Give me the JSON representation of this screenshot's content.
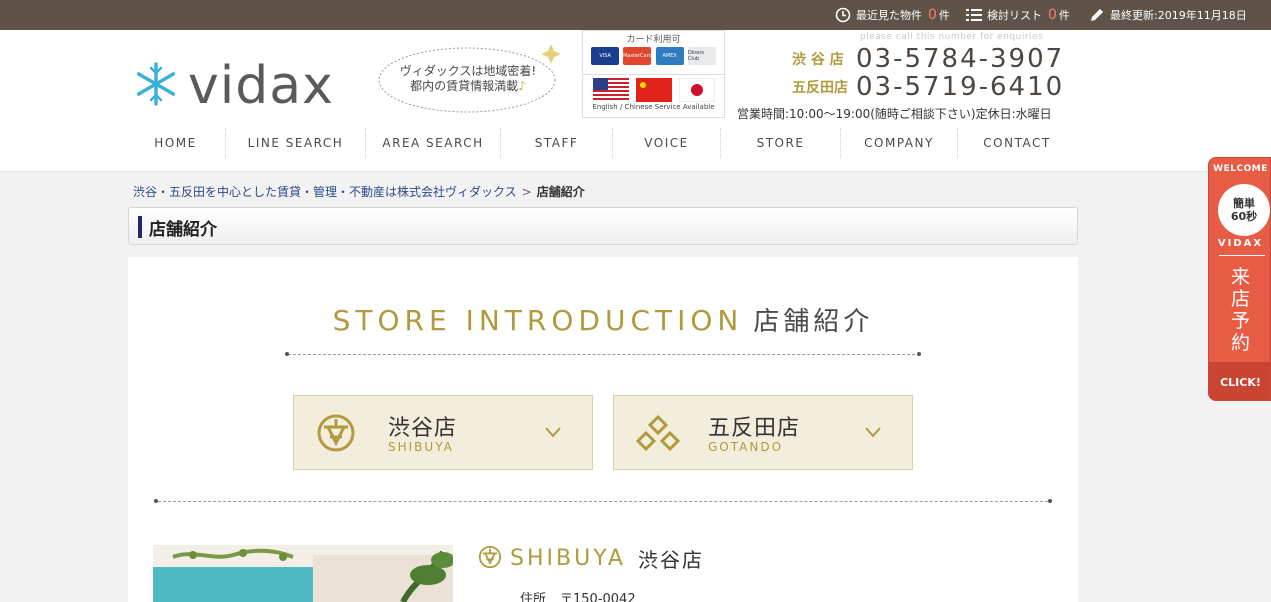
{
  "topbar": {
    "recent_label": "最近見た物件",
    "recent_count": "0",
    "recent_unit": "件",
    "list_label": "検討リスト",
    "list_count": "0",
    "list_unit": "件",
    "updated": "最終更新:2019年11月18日"
  },
  "header": {
    "logo_text": "vidax",
    "bubble_line1": "ヴィダックスは地域密着!",
    "bubble_line2": "都内の賃貸情報満載",
    "bubble_note": "♪",
    "cards_title": "カード利用可",
    "card_names": [
      "VISA",
      "MasterCard",
      "AMEX",
      "Diners Club"
    ],
    "flags_caption": "English / Chinese Service Available",
    "phone_note": "please call this number for enquiries",
    "phones": [
      {
        "store": "渋 谷 店",
        "number": "03-5784-3907"
      },
      {
        "store": "五反田店",
        "number": "03-5719-6410"
      }
    ],
    "hours": "営業時間:10:00〜19:00(随時ご相談下さい)定休日:水曜日"
  },
  "nav": [
    "HOME",
    "LINE SEARCH",
    "AREA SEARCH",
    "STAFF",
    "VOICE",
    "STORE",
    "COMPANY",
    "CONTACT"
  ],
  "breadcrumb": {
    "home": "渋谷・五反田を中心とした賃貸・管理・不動産は株式会社ヴィダックス",
    "sep": ">",
    "current": "店舗紹介"
  },
  "page_title": "店舗紹介",
  "section": {
    "title_en": "STORE INTRODUCTION",
    "title_ja": "店舗紹介"
  },
  "stores": [
    {
      "ja": "渋谷店",
      "en": "SHIBUYA"
    },
    {
      "ja": "五反田店",
      "en": "GOTANDO"
    }
  ],
  "shibuya": {
    "head_en": "SHIBUYA",
    "head_ja": "渋谷店",
    "address_label": "住所",
    "address_value": "〒150-0042"
  },
  "side_tab": {
    "welcome": "WELCOME",
    "circle_line1": "簡単",
    "circle_line2": "60秒",
    "brand": "VIDAX",
    "vertical": [
      "来",
      "店",
      "予",
      "約"
    ],
    "click": "CLICK!"
  },
  "colors": {
    "topbar_bg": "#5e5249",
    "gold": "#b09a3d",
    "side_tab": "#e85b45",
    "count": "#ff7e6b"
  }
}
